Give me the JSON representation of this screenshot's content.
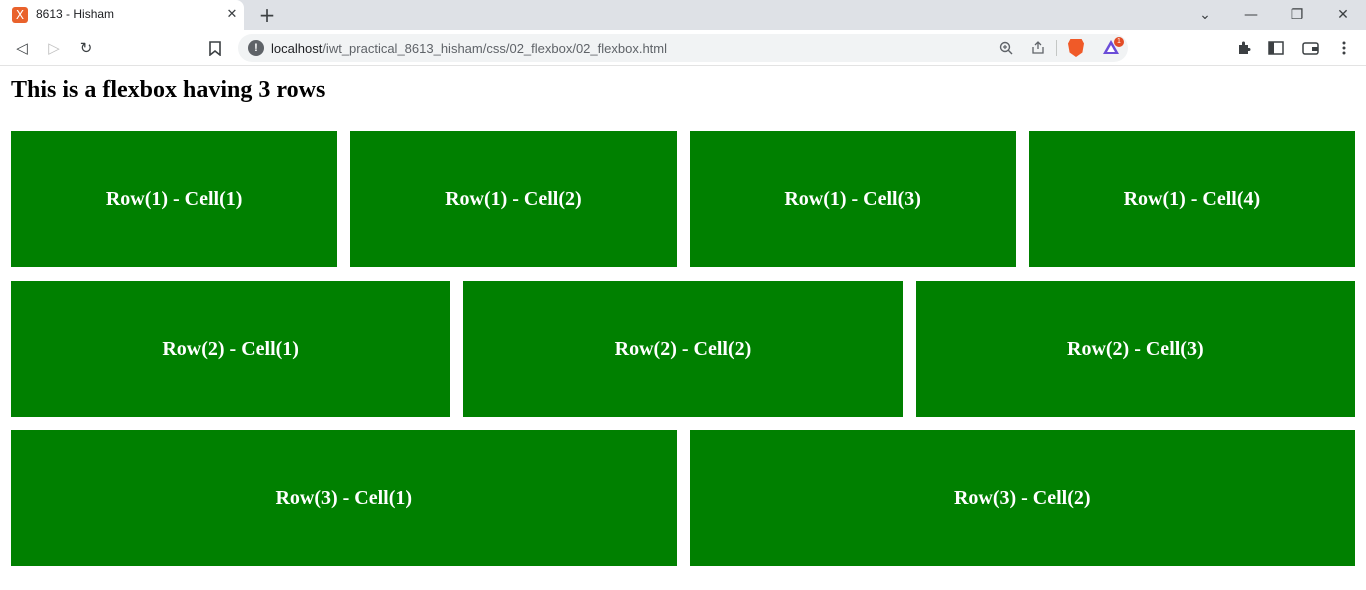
{
  "browser": {
    "tab": {
      "title": "8613 - Hisham",
      "favicon": "X"
    },
    "address": {
      "host": "localhost",
      "path": "/iwt_practical_8613_hisham/css/02_flexbox/02_flexbox.html"
    },
    "rewards_badge": "1"
  },
  "page": {
    "heading": "This is a flexbox having 3 rows",
    "cell_color": "#008000",
    "rows": [
      {
        "cells": [
          "Row(1) - Cell(1)",
          "Row(1) - Cell(2)",
          "Row(1) - Cell(3)",
          "Row(1) - Cell(4)"
        ]
      },
      {
        "cells": [
          "Row(2) - Cell(1)",
          "Row(2) - Cell(2)",
          "Row(2) - Cell(3)"
        ]
      },
      {
        "cells": [
          "Row(3) - Cell(1)",
          "Row(3) - Cell(2)"
        ]
      }
    ]
  }
}
